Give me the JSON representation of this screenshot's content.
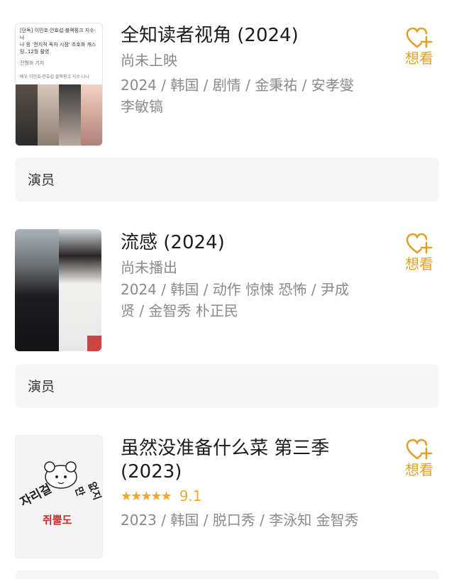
{
  "movies": [
    {
      "title": "全知读者视角 (2024)",
      "status": "尚未上映",
      "meta_line1": "2024 / 韩国 / 剧情 / 金秉祐 / 安孝燮",
      "meta_line2": "李敏镐",
      "want_label": "想看",
      "cast_label": "演员",
      "poster": {
        "headline1": "[단독] 이민호·안효섭·블랙핑크 지수·나",
        "headline2": "나 등 '전지적 독자 시점' 초호화 캐스",
        "headline3": "팅..12월 촬영",
        "byline": "전형화 기자",
        "caption": "배우 이민호·안효섭·블랙핑크 지수·나나"
      }
    },
    {
      "title": "流感 (2024)",
      "status": "尚未播出",
      "meta_line1": "2024 / 韩国 / 动作 惊悚 恐怖 / 尹成",
      "meta_line2": "贤 / 金智秀 朴正民",
      "want_label": "想看",
      "cast_label": "演员"
    },
    {
      "title_line1": "虽然没准备什么菜 第三季",
      "title_line2": "(2023)",
      "rating_stars": "★★★★★",
      "rating_value": 4.5,
      "score": "9.1",
      "meta_line1": "2023 / 韩国 / 脱口秀 / 李泳知 金智秀",
      "want_label": "想看",
      "poster": {
        "text_left": "자리걸",
        "text_center": "쥐뿔도",
        "text_right": "없지만"
      }
    }
  ],
  "colors": {
    "accent": "#e0a12c",
    "star": "#f0a92a",
    "muted": "#8a8a8a",
    "bar_bg": "#f5f5f5"
  }
}
